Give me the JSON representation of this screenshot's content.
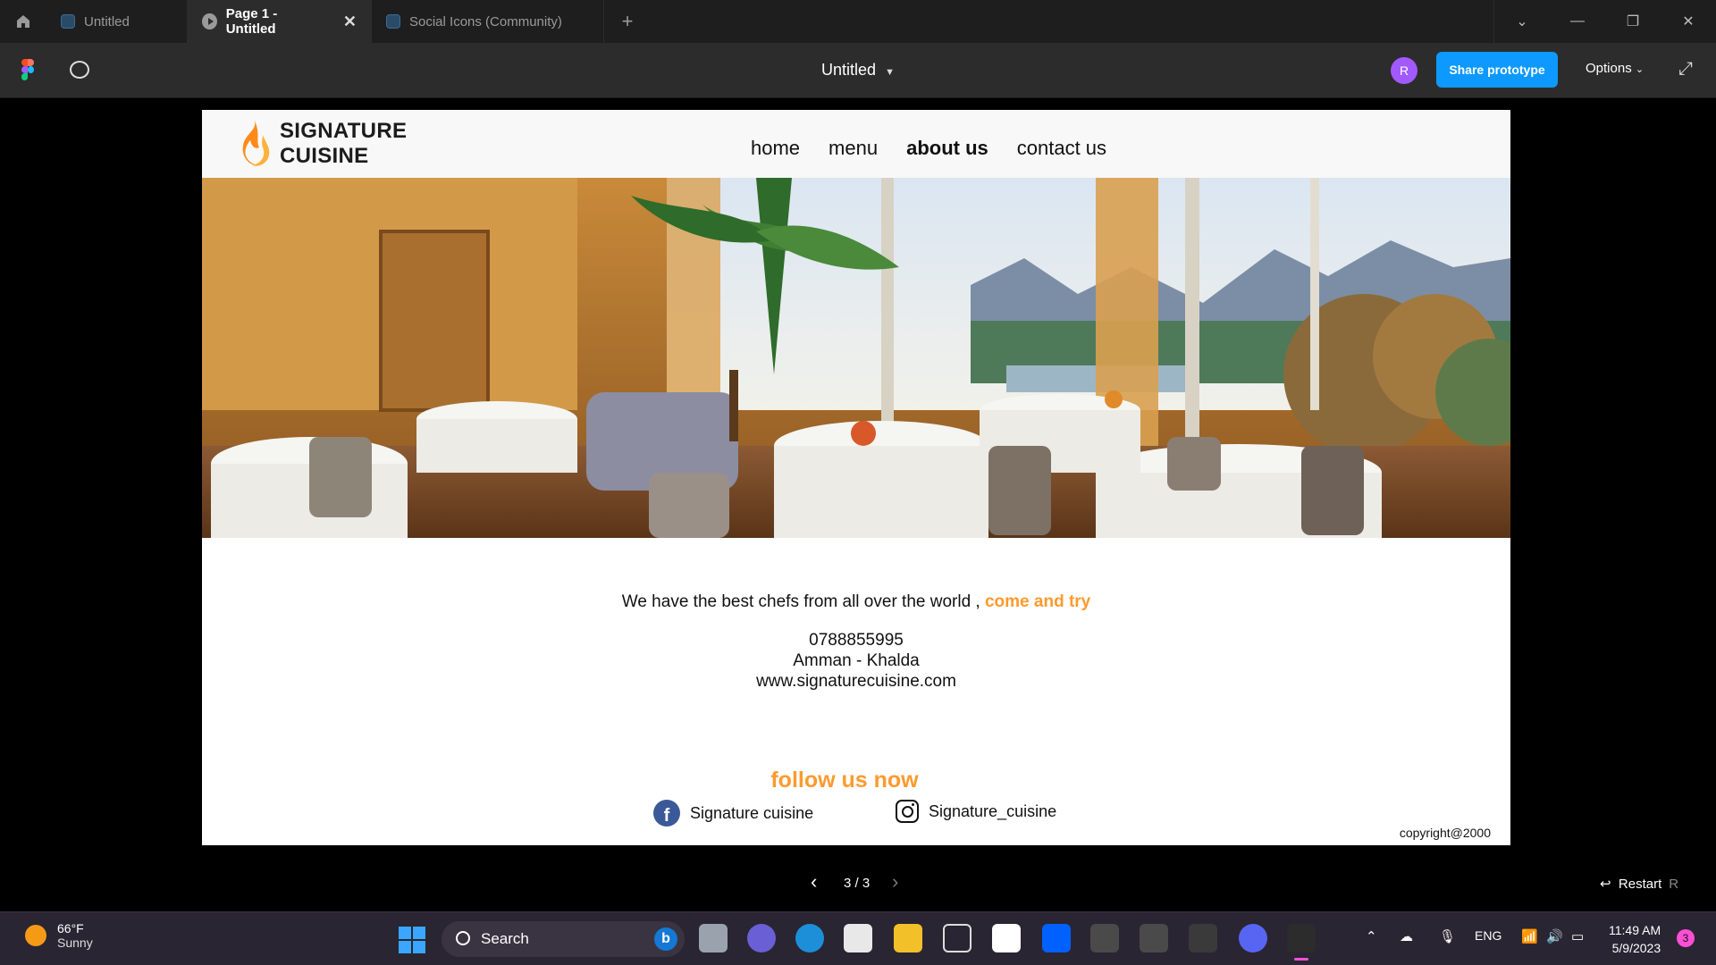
{
  "browser": {
    "tabs": [
      {
        "label": "Untitled",
        "active": false
      },
      {
        "label": "Page 1 - Untitled",
        "active": true
      },
      {
        "label": "Social Icons (Community)",
        "active": false
      }
    ],
    "new_tab_label": "+"
  },
  "figma": {
    "document_title": "Untitled",
    "avatar_initial": "R",
    "share_label": "Share prototype",
    "options_label": "Options"
  },
  "site": {
    "brand_line1": "SIGNATURE",
    "brand_line2": "CUISINE",
    "nav": [
      "home",
      "menu",
      "about us",
      "contact us"
    ],
    "current_nav": "about us",
    "tagline_main": "We have the best chefs from all over the world ,",
    "tagline_accent": "come and try",
    "phone": "0788855995",
    "address": "Amman - Khalda",
    "website": "www.signaturecuisine.com",
    "follow_title": "follow us now",
    "facebook_label": "Signature cuisine",
    "instagram_label": "Signature_cuisine",
    "copyright": "copyright@2000",
    "accent_color": "#ff9a2e"
  },
  "prototype_nav": {
    "counter": "3 / 3",
    "restart_label": "Restart",
    "restart_key": "R"
  },
  "taskbar": {
    "temperature": "66°F",
    "condition": "Sunny",
    "search_label": "Search",
    "language": "ENG",
    "time": "11:49 AM",
    "date": "5/9/2023",
    "notification_count": "3"
  }
}
